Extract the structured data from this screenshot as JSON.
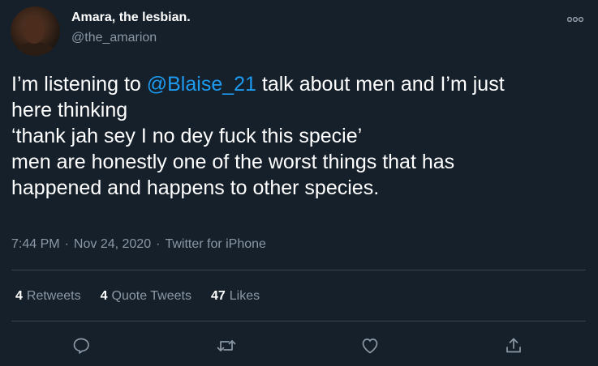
{
  "user": {
    "display_name": "Amara, the lesbian.",
    "handle": "@the_amarion"
  },
  "tweet": {
    "line1_before": "I’m listening to ",
    "mention": "@Blaise_21",
    "line1_after": " talk about men and I’m just",
    "line2": "here thinking",
    "line3": "‘thank jah sey I no dey fuck this specie’",
    "line4": "men are honestly one of the worst things that has",
    "line5": "happened and happens to other species."
  },
  "meta": {
    "time": "7:44 PM",
    "date": "Nov 24, 2020",
    "source": "Twitter for iPhone",
    "separator": "·"
  },
  "stats": {
    "retweets_count": "4",
    "retweets_label": "Retweets",
    "quotes_count": "4",
    "quotes_label": "Quote Tweets",
    "likes_count": "47",
    "likes_label": "Likes"
  },
  "colors": {
    "background": "#15202b",
    "text": "#ffffff",
    "secondary": "#8b98a5",
    "accent": "#1d9bf0",
    "divider": "#38444d"
  },
  "icons": [
    "more-icon",
    "reply-icon",
    "retweet-icon",
    "like-icon",
    "share-icon"
  ]
}
